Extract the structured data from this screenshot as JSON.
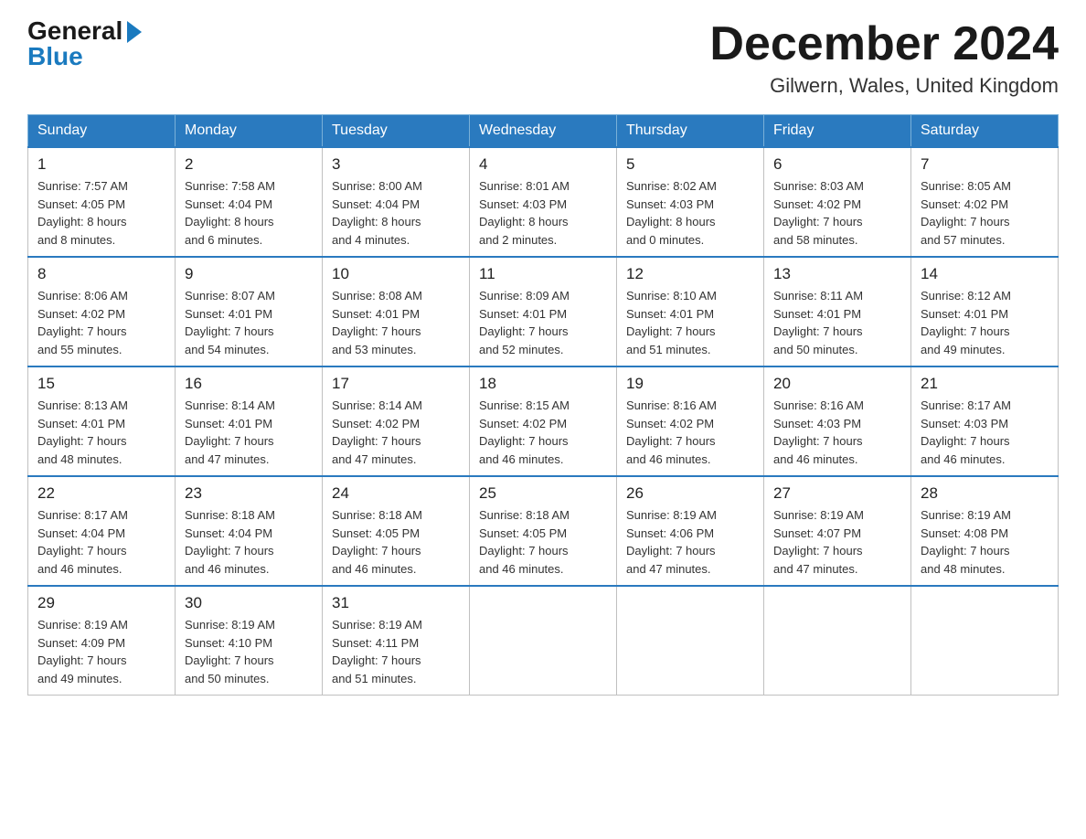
{
  "logo": {
    "general": "General",
    "arrow": "▶",
    "blue": "Blue"
  },
  "header": {
    "month_title": "December 2024",
    "location": "Gilwern, Wales, United Kingdom"
  },
  "days_of_week": [
    "Sunday",
    "Monday",
    "Tuesday",
    "Wednesday",
    "Thursday",
    "Friday",
    "Saturday"
  ],
  "weeks": [
    [
      {
        "day": "1",
        "info": "Sunrise: 7:57 AM\nSunset: 4:05 PM\nDaylight: 8 hours\nand 8 minutes."
      },
      {
        "day": "2",
        "info": "Sunrise: 7:58 AM\nSunset: 4:04 PM\nDaylight: 8 hours\nand 6 minutes."
      },
      {
        "day": "3",
        "info": "Sunrise: 8:00 AM\nSunset: 4:04 PM\nDaylight: 8 hours\nand 4 minutes."
      },
      {
        "day": "4",
        "info": "Sunrise: 8:01 AM\nSunset: 4:03 PM\nDaylight: 8 hours\nand 2 minutes."
      },
      {
        "day": "5",
        "info": "Sunrise: 8:02 AM\nSunset: 4:03 PM\nDaylight: 8 hours\nand 0 minutes."
      },
      {
        "day": "6",
        "info": "Sunrise: 8:03 AM\nSunset: 4:02 PM\nDaylight: 7 hours\nand 58 minutes."
      },
      {
        "day": "7",
        "info": "Sunrise: 8:05 AM\nSunset: 4:02 PM\nDaylight: 7 hours\nand 57 minutes."
      }
    ],
    [
      {
        "day": "8",
        "info": "Sunrise: 8:06 AM\nSunset: 4:02 PM\nDaylight: 7 hours\nand 55 minutes."
      },
      {
        "day": "9",
        "info": "Sunrise: 8:07 AM\nSunset: 4:01 PM\nDaylight: 7 hours\nand 54 minutes."
      },
      {
        "day": "10",
        "info": "Sunrise: 8:08 AM\nSunset: 4:01 PM\nDaylight: 7 hours\nand 53 minutes."
      },
      {
        "day": "11",
        "info": "Sunrise: 8:09 AM\nSunset: 4:01 PM\nDaylight: 7 hours\nand 52 minutes."
      },
      {
        "day": "12",
        "info": "Sunrise: 8:10 AM\nSunset: 4:01 PM\nDaylight: 7 hours\nand 51 minutes."
      },
      {
        "day": "13",
        "info": "Sunrise: 8:11 AM\nSunset: 4:01 PM\nDaylight: 7 hours\nand 50 minutes."
      },
      {
        "day": "14",
        "info": "Sunrise: 8:12 AM\nSunset: 4:01 PM\nDaylight: 7 hours\nand 49 minutes."
      }
    ],
    [
      {
        "day": "15",
        "info": "Sunrise: 8:13 AM\nSunset: 4:01 PM\nDaylight: 7 hours\nand 48 minutes."
      },
      {
        "day": "16",
        "info": "Sunrise: 8:14 AM\nSunset: 4:01 PM\nDaylight: 7 hours\nand 47 minutes."
      },
      {
        "day": "17",
        "info": "Sunrise: 8:14 AM\nSunset: 4:02 PM\nDaylight: 7 hours\nand 47 minutes."
      },
      {
        "day": "18",
        "info": "Sunrise: 8:15 AM\nSunset: 4:02 PM\nDaylight: 7 hours\nand 46 minutes."
      },
      {
        "day": "19",
        "info": "Sunrise: 8:16 AM\nSunset: 4:02 PM\nDaylight: 7 hours\nand 46 minutes."
      },
      {
        "day": "20",
        "info": "Sunrise: 8:16 AM\nSunset: 4:03 PM\nDaylight: 7 hours\nand 46 minutes."
      },
      {
        "day": "21",
        "info": "Sunrise: 8:17 AM\nSunset: 4:03 PM\nDaylight: 7 hours\nand 46 minutes."
      }
    ],
    [
      {
        "day": "22",
        "info": "Sunrise: 8:17 AM\nSunset: 4:04 PM\nDaylight: 7 hours\nand 46 minutes."
      },
      {
        "day": "23",
        "info": "Sunrise: 8:18 AM\nSunset: 4:04 PM\nDaylight: 7 hours\nand 46 minutes."
      },
      {
        "day": "24",
        "info": "Sunrise: 8:18 AM\nSunset: 4:05 PM\nDaylight: 7 hours\nand 46 minutes."
      },
      {
        "day": "25",
        "info": "Sunrise: 8:18 AM\nSunset: 4:05 PM\nDaylight: 7 hours\nand 46 minutes."
      },
      {
        "day": "26",
        "info": "Sunrise: 8:19 AM\nSunset: 4:06 PM\nDaylight: 7 hours\nand 47 minutes."
      },
      {
        "day": "27",
        "info": "Sunrise: 8:19 AM\nSunset: 4:07 PM\nDaylight: 7 hours\nand 47 minutes."
      },
      {
        "day": "28",
        "info": "Sunrise: 8:19 AM\nSunset: 4:08 PM\nDaylight: 7 hours\nand 48 minutes."
      }
    ],
    [
      {
        "day": "29",
        "info": "Sunrise: 8:19 AM\nSunset: 4:09 PM\nDaylight: 7 hours\nand 49 minutes."
      },
      {
        "day": "30",
        "info": "Sunrise: 8:19 AM\nSunset: 4:10 PM\nDaylight: 7 hours\nand 50 minutes."
      },
      {
        "day": "31",
        "info": "Sunrise: 8:19 AM\nSunset: 4:11 PM\nDaylight: 7 hours\nand 51 minutes."
      },
      null,
      null,
      null,
      null
    ]
  ]
}
